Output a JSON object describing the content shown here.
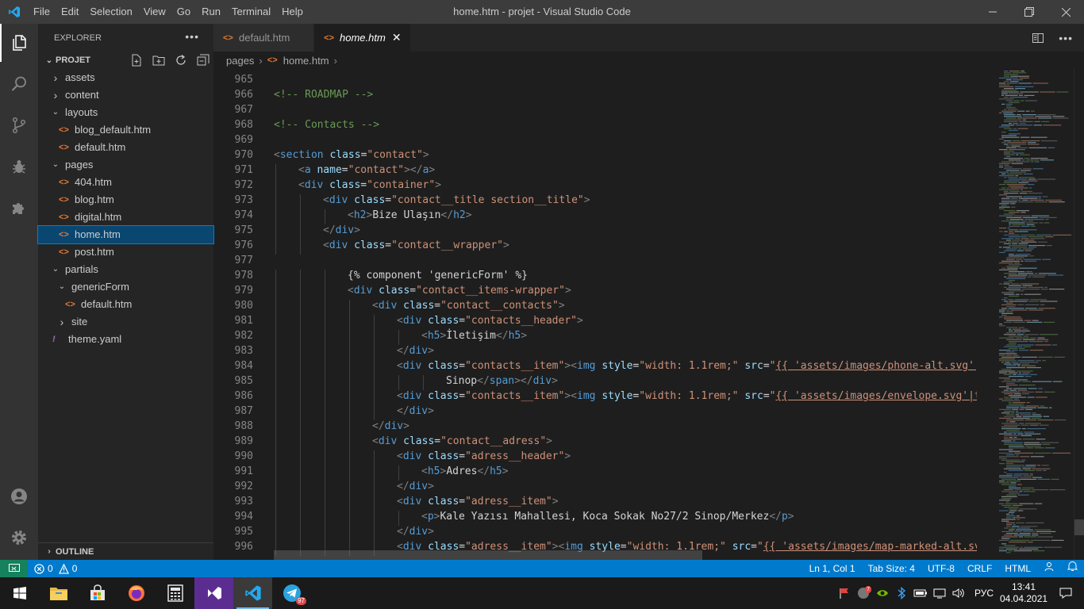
{
  "titlebar": {
    "menus": [
      "File",
      "Edit",
      "Selection",
      "View",
      "Go",
      "Run",
      "Terminal",
      "Help"
    ],
    "title": "home.htm - projet - Visual Studio Code"
  },
  "explorer": {
    "title": "EXPLORER",
    "project": "PROJET",
    "tree": [
      {
        "label": "assets",
        "type": "folder",
        "open": false,
        "depth": 1
      },
      {
        "label": "content",
        "type": "folder",
        "open": false,
        "depth": 1
      },
      {
        "label": "layouts",
        "type": "folder",
        "open": true,
        "depth": 1
      },
      {
        "label": "blog_default.htm",
        "type": "file",
        "depth": 2
      },
      {
        "label": "default.htm",
        "type": "file",
        "depth": 2
      },
      {
        "label": "pages",
        "type": "folder",
        "open": true,
        "depth": 1
      },
      {
        "label": "404.htm",
        "type": "file",
        "depth": 2
      },
      {
        "label": "blog.htm",
        "type": "file",
        "depth": 2
      },
      {
        "label": "digital.htm",
        "type": "file",
        "depth": 2
      },
      {
        "label": "home.htm",
        "type": "file",
        "depth": 2,
        "selected": true
      },
      {
        "label": "post.htm",
        "type": "file",
        "depth": 2
      },
      {
        "label": "partials",
        "type": "folder",
        "open": true,
        "depth": 1
      },
      {
        "label": "genericForm",
        "type": "folder",
        "open": true,
        "depth": 2
      },
      {
        "label": "default.htm",
        "type": "file",
        "depth": 3
      },
      {
        "label": "site",
        "type": "folder",
        "open": false,
        "depth": 2
      },
      {
        "label": "theme.yaml",
        "type": "yaml",
        "depth": 1
      }
    ],
    "outline": "OUTLINE"
  },
  "tabs": [
    {
      "label": "default.htm",
      "active": false
    },
    {
      "label": "home.htm",
      "active": true
    }
  ],
  "breadcrumb": [
    "pages",
    "home.htm"
  ],
  "editor": {
    "lines": [
      {
        "n": "965",
        "indent": 0,
        "html": ""
      },
      {
        "n": "966",
        "indent": 0,
        "html": "<span class=\"c\">&lt;!-- ROADMAP --&gt;</span>"
      },
      {
        "n": "967",
        "indent": 0,
        "html": ""
      },
      {
        "n": "968",
        "indent": 0,
        "html": "<span class=\"c\">&lt;!-- Contacts --&gt;</span>"
      },
      {
        "n": "969",
        "indent": 0,
        "html": ""
      },
      {
        "n": "970",
        "indent": 0,
        "html": "<span class=\"p\">&lt;</span><span class=\"t\">section</span> <span class=\"a\">class</span>=<span class=\"s\">\"contact\"</span><span class=\"p\">&gt;</span>"
      },
      {
        "n": "971",
        "indent": 1,
        "html": "<span class=\"p\">&lt;</span><span class=\"t\">a</span> <span class=\"a\">name</span>=<span class=\"s\">\"contact\"</span><span class=\"p\">&gt;&lt;/</span><span class=\"t\">a</span><span class=\"p\">&gt;</span>"
      },
      {
        "n": "972",
        "indent": 1,
        "html": "<span class=\"p\">&lt;</span><span class=\"t\">div</span> <span class=\"a\">class</span>=<span class=\"s\">\"container\"</span><span class=\"p\">&gt;</span>"
      },
      {
        "n": "973",
        "indent": 2,
        "html": "<span class=\"p\">&lt;</span><span class=\"t\">div</span> <span class=\"a\">class</span>=<span class=\"s\">\"contact__title section__title\"</span><span class=\"p\">&gt;</span>"
      },
      {
        "n": "974",
        "indent": 3,
        "html": "<span class=\"p\">&lt;</span><span class=\"t\">h2</span><span class=\"p\">&gt;</span>Bize Ulaşın<span class=\"p\">&lt;/</span><span class=\"t\">h2</span><span class=\"p\">&gt;</span>"
      },
      {
        "n": "975",
        "indent": 2,
        "html": "<span class=\"p\">&lt;/</span><span class=\"t\">div</span><span class=\"p\">&gt;</span>"
      },
      {
        "n": "976",
        "indent": 2,
        "html": "<span class=\"p\">&lt;</span><span class=\"t\">div</span> <span class=\"a\">class</span>=<span class=\"s\">\"contact__wrapper\"</span><span class=\"p\">&gt;</span>"
      },
      {
        "n": "977",
        "indent": 0,
        "html": ""
      },
      {
        "n": "978",
        "indent": 3,
        "html": "{% component 'genericForm' %}"
      },
      {
        "n": "979",
        "indent": 3,
        "html": "<span class=\"p\">&lt;</span><span class=\"t\">div</span> <span class=\"a\">class</span>=<span class=\"s\">\"contact__items-wrapper\"</span><span class=\"p\">&gt;</span>"
      },
      {
        "n": "980",
        "indent": 4,
        "html": "<span class=\"p\">&lt;</span><span class=\"t\">div</span> <span class=\"a\">class</span>=<span class=\"s\">\"contact__contacts\"</span><span class=\"p\">&gt;</span>"
      },
      {
        "n": "981",
        "indent": 5,
        "html": "<span class=\"p\">&lt;</span><span class=\"t\">div</span> <span class=\"a\">class</span>=<span class=\"s\">\"contacts__header\"</span><span class=\"p\">&gt;</span>"
      },
      {
        "n": "982",
        "indent": 6,
        "html": "<span class=\"p\">&lt;</span><span class=\"t\">h5</span><span class=\"p\">&gt;</span>İletişim<span class=\"p\">&lt;/</span><span class=\"t\">h5</span><span class=\"p\">&gt;</span>"
      },
      {
        "n": "983",
        "indent": 5,
        "html": "<span class=\"p\">&lt;/</span><span class=\"t\">div</span><span class=\"p\">&gt;</span>"
      },
      {
        "n": "984",
        "indent": 5,
        "html": "<span class=\"p\">&lt;</span><span class=\"t\">div</span> <span class=\"a\">class</span>=<span class=\"s\">\"contacts__item\"</span><span class=\"p\">&gt;&lt;</span><span class=\"t\">img</span> <span class=\"a\">style</span>=<span class=\"s\">\"width: 1.1rem;\"</span> <span class=\"a\">src</span>=<span class=\"s\">\"</span><span class=\"u\">{{ 'assets/images/phone-alt.svg'|theme }}</span>"
      },
      {
        "n": "985",
        "indent": 7,
        "html": "Sinop<span class=\"p\">&lt;/</span><span class=\"t\">span</span><span class=\"p\">&gt;&lt;/</span><span class=\"t\">div</span><span class=\"p\">&gt;</span>"
      },
      {
        "n": "986",
        "indent": 5,
        "html": "<span class=\"p\">&lt;</span><span class=\"t\">div</span> <span class=\"a\">class</span>=<span class=\"s\">\"contacts__item\"</span><span class=\"p\">&gt;&lt;</span><span class=\"t\">img</span> <span class=\"a\">style</span>=<span class=\"s\">\"width: 1.1rem;\"</span> <span class=\"a\">src</span>=<span class=\"s\">\"</span><span class=\"u\">{{ 'assets/images/envelope.svg'|theme }}</span>"
      },
      {
        "n": "987",
        "indent": 5,
        "html": "<span class=\"p\">&lt;/</span><span class=\"t\">div</span><span class=\"p\">&gt;</span>"
      },
      {
        "n": "988",
        "indent": 4,
        "html": "<span class=\"p\">&lt;/</span><span class=\"t\">div</span><span class=\"p\">&gt;</span>"
      },
      {
        "n": "989",
        "indent": 4,
        "html": "<span class=\"p\">&lt;</span><span class=\"t\">div</span> <span class=\"a\">class</span>=<span class=\"s\">\"contact__adress\"</span><span class=\"p\">&gt;</span>"
      },
      {
        "n": "990",
        "indent": 5,
        "html": "<span class=\"p\">&lt;</span><span class=\"t\">div</span> <span class=\"a\">class</span>=<span class=\"s\">\"adress__header\"</span><span class=\"p\">&gt;</span>"
      },
      {
        "n": "991",
        "indent": 6,
        "html": "<span class=\"p\">&lt;</span><span class=\"t\">h5</span><span class=\"p\">&gt;</span>Adres<span class=\"p\">&lt;/</span><span class=\"t\">h5</span><span class=\"p\">&gt;</span>"
      },
      {
        "n": "992",
        "indent": 5,
        "html": "<span class=\"p\">&lt;/</span><span class=\"t\">div</span><span class=\"p\">&gt;</span>"
      },
      {
        "n": "993",
        "indent": 5,
        "html": "<span class=\"p\">&lt;</span><span class=\"t\">div</span> <span class=\"a\">class</span>=<span class=\"s\">\"adress__item\"</span><span class=\"p\">&gt;</span>"
      },
      {
        "n": "994",
        "indent": 6,
        "html": "<span class=\"p\">&lt;</span><span class=\"t\">p</span><span class=\"p\">&gt;</span>Kale Yazısı Mahallesi, Koca Sokak No27/2 Sinop/Merkez<span class=\"p\">&lt;/</span><span class=\"t\">p</span><span class=\"p\">&gt;</span>"
      },
      {
        "n": "995",
        "indent": 5,
        "html": "<span class=\"p\">&lt;/</span><span class=\"t\">div</span><span class=\"p\">&gt;</span>"
      },
      {
        "n": "996",
        "indent": 5,
        "html": "<span class=\"p\">&lt;</span><span class=\"t\">div</span> <span class=\"a\">class</span>=<span class=\"s\">\"adress__item\"</span><span class=\"p\">&gt;&lt;</span><span class=\"t\">img</span> <span class=\"a\">style</span>=<span class=\"s\">\"width: 1.1rem;\"</span> <span class=\"a\">src</span>=<span class=\"s\">\"</span><span class=\"u\">{{ 'assets/images/map-marked-alt.svg'|theme }}</span>"
      }
    ]
  },
  "statusbar": {
    "errors": "0",
    "warnings": "0",
    "position": "Ln 1, Col 1",
    "tabsize": "Tab Size: 4",
    "encoding": "UTF-8",
    "eol": "CRLF",
    "language": "HTML"
  },
  "taskbar": {
    "language": "РУС",
    "time": "13:41",
    "date": "04.04.2021",
    "telegram_badge": "97",
    "notify_badge": "7"
  }
}
